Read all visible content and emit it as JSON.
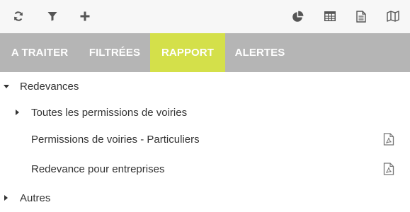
{
  "toolbar": {
    "left_icons": [
      "refresh-icon",
      "filter-icon",
      "plus-icon"
    ],
    "right_icons": [
      "pie-chart-icon",
      "table-icon",
      "document-icon",
      "map-icon"
    ]
  },
  "tabs": [
    {
      "label": "A TRAITER",
      "active": false
    },
    {
      "label": "FILTRÉES",
      "active": false
    },
    {
      "label": "RAPPORT",
      "active": true
    },
    {
      "label": "ALERTES",
      "active": false
    }
  ],
  "colors": {
    "accent": "#d4e04a",
    "tab_bar": "#b5b5b5",
    "toolbar_bg": "#f7f7f7",
    "text": "#333333"
  },
  "tree": {
    "groups": [
      {
        "label": "Redevances",
        "expanded": true,
        "items": [
          {
            "label": "Toutes les permissions de voiries",
            "expandable": true,
            "icon": ""
          },
          {
            "label": "Permissions de voiries - Particuliers",
            "expandable": false,
            "icon": "pdf-icon"
          },
          {
            "label": "Redevance pour entreprises",
            "expandable": false,
            "icon": "pdf-icon"
          }
        ]
      },
      {
        "label": "Autres",
        "expanded": false,
        "items": []
      }
    ]
  }
}
